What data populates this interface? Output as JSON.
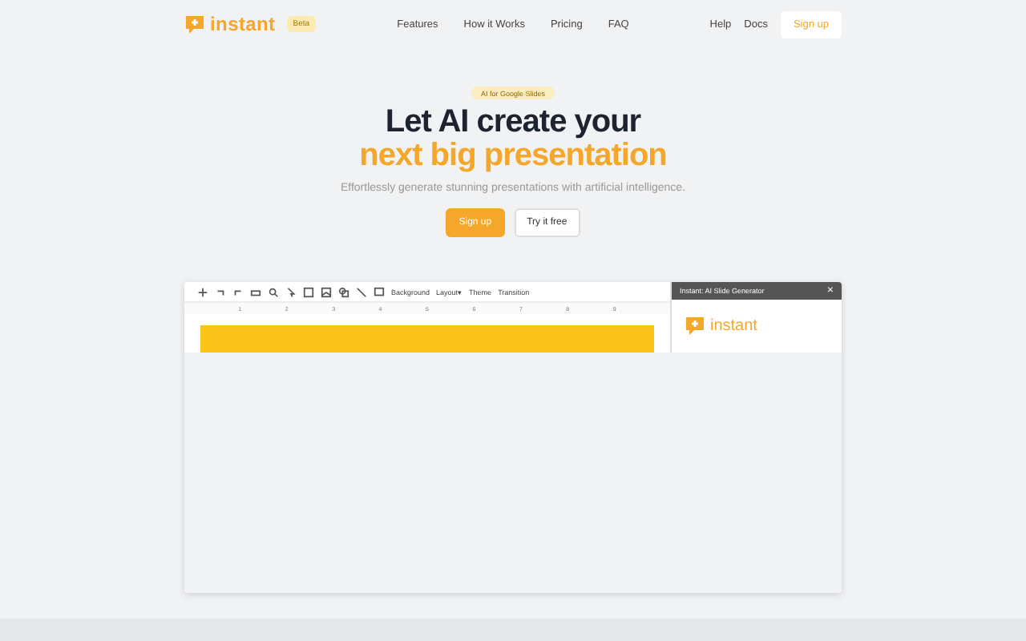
{
  "nav": {
    "brand": "instant",
    "badge": "Beta",
    "links": [
      "Features",
      "How it Works",
      "Pricing",
      "FAQ"
    ],
    "right_links": [
      "Help",
      "Docs"
    ],
    "signup": "Sign up"
  },
  "hero": {
    "tag": "AI for Google Slides",
    "title_line1": "Let AI create your",
    "title_line2": "next big presentation",
    "subtitle": "Effortlessly generate stunning presentations with artificial intelligence.",
    "buttons": [
      {
        "label": "Sign up",
        "kind": "primary"
      },
      {
        "label": "Try it free",
        "kind": "secondary"
      }
    ]
  },
  "editor": {
    "toolbar_items": [
      "Background",
      "Layout▾",
      "Theme",
      "Transition"
    ],
    "ruler": [
      "1",
      "2",
      "3",
      "4",
      "5",
      "6",
      "7",
      "8",
      "9"
    ],
    "panel": {
      "title": "Instant: AI Slide Generator",
      "close": "×",
      "brand": "instant"
    }
  }
}
